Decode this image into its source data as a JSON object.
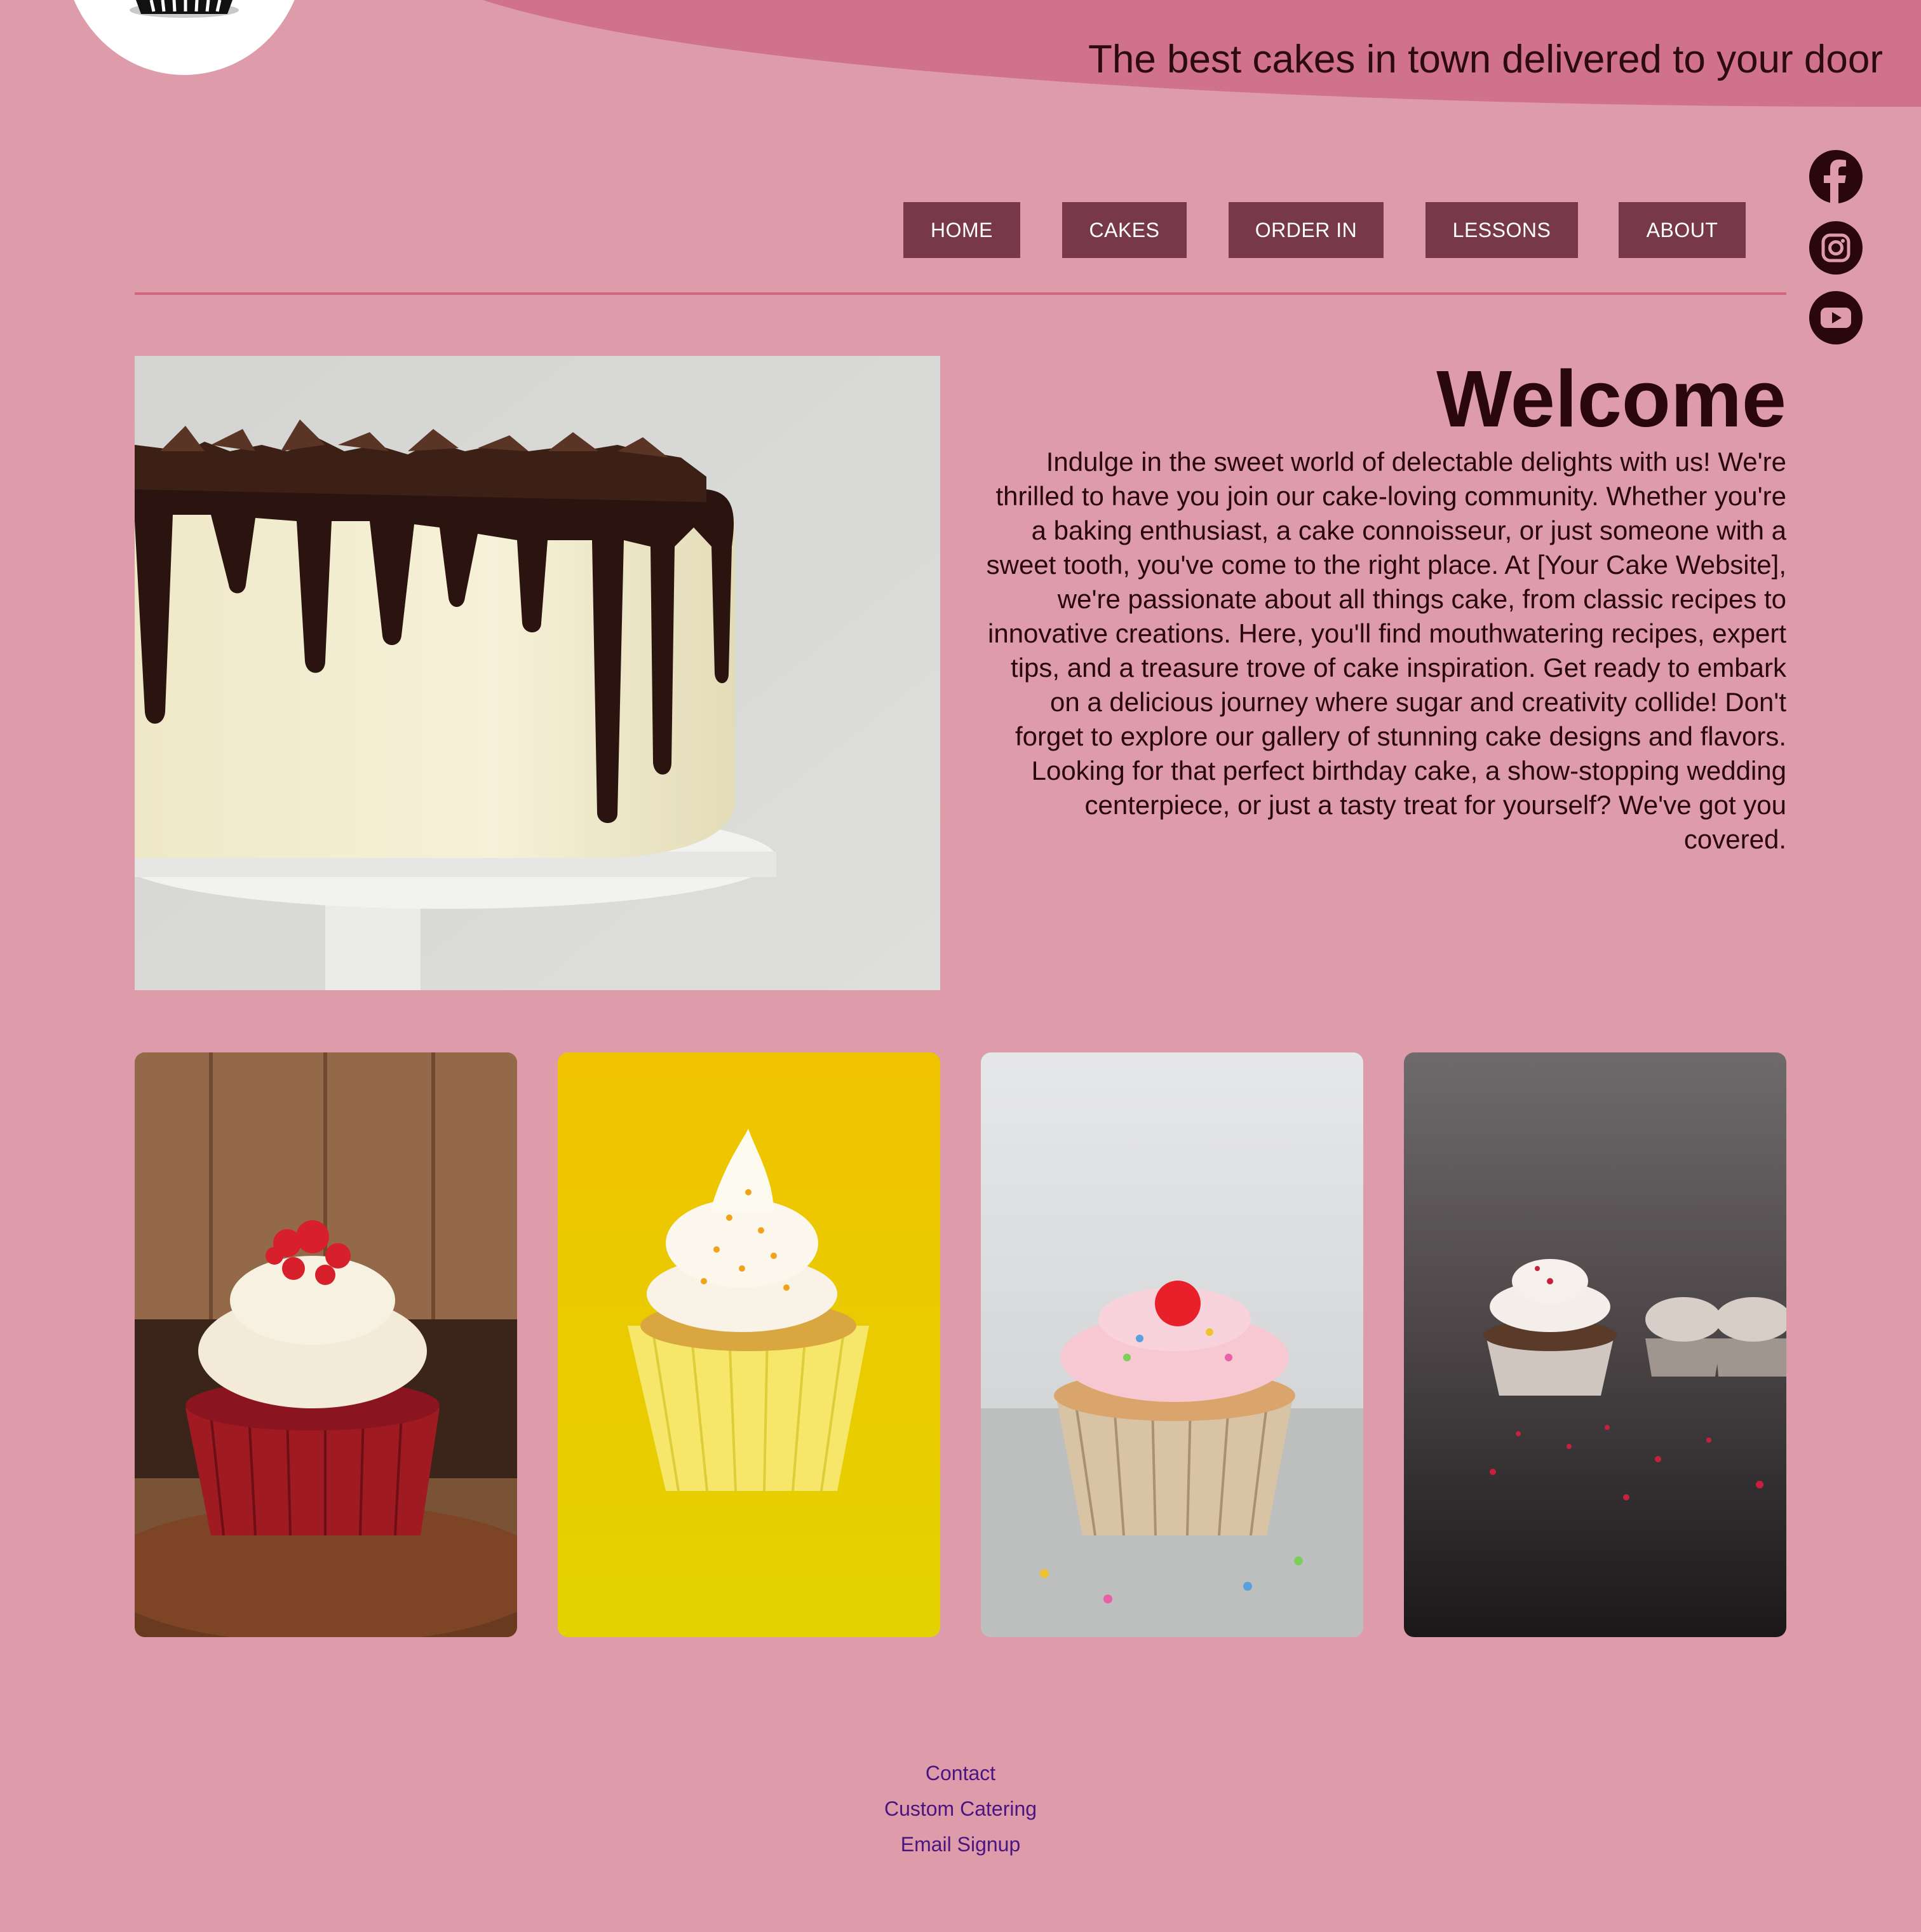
{
  "header": {
    "tagline": "The best cakes in town delivered to your door",
    "logo_icon": "cake-logo-icon"
  },
  "nav": {
    "items": [
      {
        "label": "HOME"
      },
      {
        "label": "CAKES"
      },
      {
        "label": "ORDER IN"
      },
      {
        "label": "LESSONS"
      },
      {
        "label": "ABOUT"
      }
    ]
  },
  "social": [
    {
      "icon": "facebook-icon"
    },
    {
      "icon": "instagram-icon"
    },
    {
      "icon": "youtube-icon"
    }
  ],
  "welcome": {
    "title": "Welcome",
    "body": "Indulge in the sweet world of delectable delights with us! We're thrilled to have you join our cake-loving community. Whether you're a baking enthusiast, a cake connoisseur, or just someone with a sweet tooth, you've come to the right place. At [Your Cake Website], we're passionate about all things cake, from classic recipes to innovative creations. Here, you'll find mouthwatering recipes, expert tips, and a treasure trove of cake inspiration. Get ready to embark on a delicious journey where sugar and creativity collide! Don't forget to explore our gallery of stunning cake designs and flavors. Looking for that perfect birthday cake, a show-stopping wedding centerpiece, or just a tasty treat for yourself? We've got you covered."
  },
  "footer": {
    "links": [
      {
        "label": "Contact"
      },
      {
        "label": "Custom Catering"
      },
      {
        "label": "Email Signup"
      }
    ]
  },
  "colors": {
    "background": "#de9cab",
    "wave": "#d1728b",
    "nav_button": "#77384a",
    "text_dark": "#2a060d",
    "footer_link": "#4a1580"
  }
}
